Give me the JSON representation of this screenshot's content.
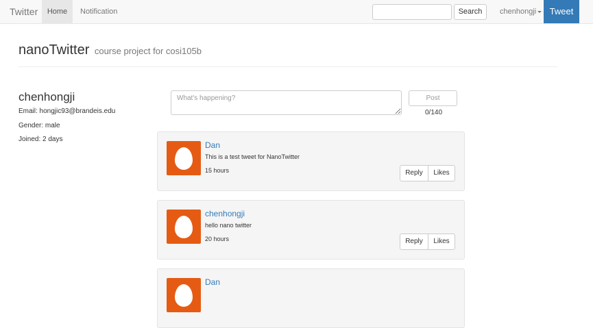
{
  "navbar": {
    "brand": "Twitter",
    "home": "Home",
    "notification": "Notification",
    "search_value": "",
    "search_button": "Search",
    "user": "chenhongji",
    "tweet_button": "Tweet"
  },
  "header": {
    "title": "nanoTwitter",
    "subtitle": "course project for cosi105b"
  },
  "profile": {
    "name": "chenhongji",
    "email": "Email: hongjic93@brandeis.edu",
    "gender": "Gender: male",
    "joined": "Joined: 2 days"
  },
  "composer": {
    "placeholder": "What's happening?",
    "post_button": "Post",
    "counter": "0/140"
  },
  "tweets": [
    {
      "author": "Dan",
      "text": "This is a test tweet for NanoTwitter",
      "time": "15 hours",
      "reply": "Reply",
      "likes": "Likes"
    },
    {
      "author": "chenhongji",
      "text": "hello nano twitter",
      "time": "20 hours",
      "reply": "Reply",
      "likes": "Likes"
    },
    {
      "author": "Dan"
    }
  ],
  "colors": {
    "brand_blue": "#337ab7",
    "avatar_orange": "#e55b13",
    "navbar_bg": "#f8f8f8",
    "card_bg": "#f5f5f5"
  }
}
